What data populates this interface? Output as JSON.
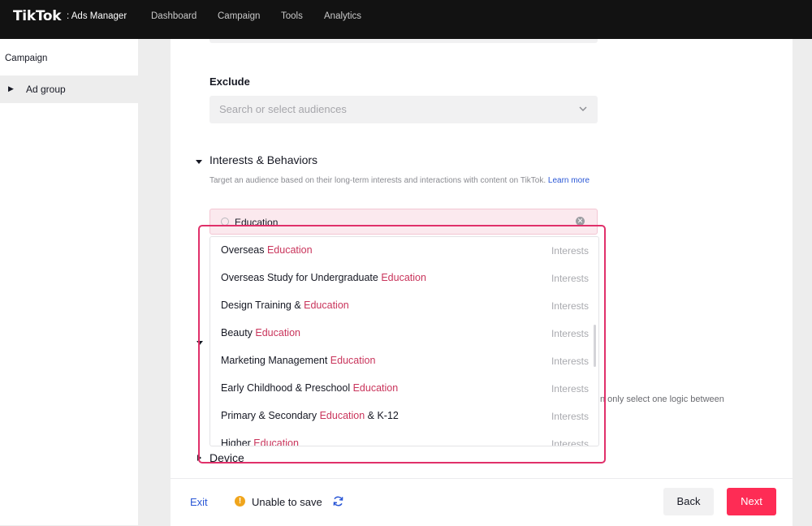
{
  "app": {
    "brand": "TikTok",
    "brand_sub": ": Ads Manager",
    "nav": [
      "Dashboard",
      "Campaign",
      "Tools",
      "Analytics"
    ]
  },
  "sidebar": {
    "title": "Campaign",
    "items": [
      {
        "label": "Ad group"
      }
    ]
  },
  "exclude": {
    "label": "Exclude",
    "placeholder": "Search or select audiences"
  },
  "interests": {
    "title": "Interests & Behaviors",
    "description": "Target an audience based on their long-term interests and interactions with content on TikTok.",
    "learn_more": "Learn more",
    "search_value": "Education",
    "clear_symbol": "✕",
    "options": [
      {
        "pre": "Overseas ",
        "hl": "Education",
        "post": "",
        "type": "Interests"
      },
      {
        "pre": "Overseas Study for Undergraduate ",
        "hl": "Education",
        "post": "",
        "type": "Interests"
      },
      {
        "pre": "Design Training & ",
        "hl": "Education",
        "post": "",
        "type": "Interests"
      },
      {
        "pre": "Beauty ",
        "hl": "Education",
        "post": "",
        "type": "Interests"
      },
      {
        "pre": "Marketing Management ",
        "hl": "Education",
        "post": "",
        "type": "Interests"
      },
      {
        "pre": "Early Childhood & Preschool ",
        "hl": "Education",
        "post": "",
        "type": "Interests"
      },
      {
        "pre": "Primary & Secondary ",
        "hl": "Education",
        "post": " & K-12",
        "type": "Interests"
      },
      {
        "pre": "Higher ",
        "hl": "Education",
        "post": "",
        "type": "Interests"
      }
    ],
    "partial_text": "n only select one logic between"
  },
  "device": {
    "title": "Device"
  },
  "footer": {
    "exit": "Exit",
    "warning_icon": "!",
    "status": "Unable to save",
    "back": "Back",
    "next": "Next"
  },
  "colors": {
    "accent": "#fe2c55",
    "highlight_text": "#c9345b",
    "link": "#2a57d6",
    "warning": "#f0a51c"
  }
}
